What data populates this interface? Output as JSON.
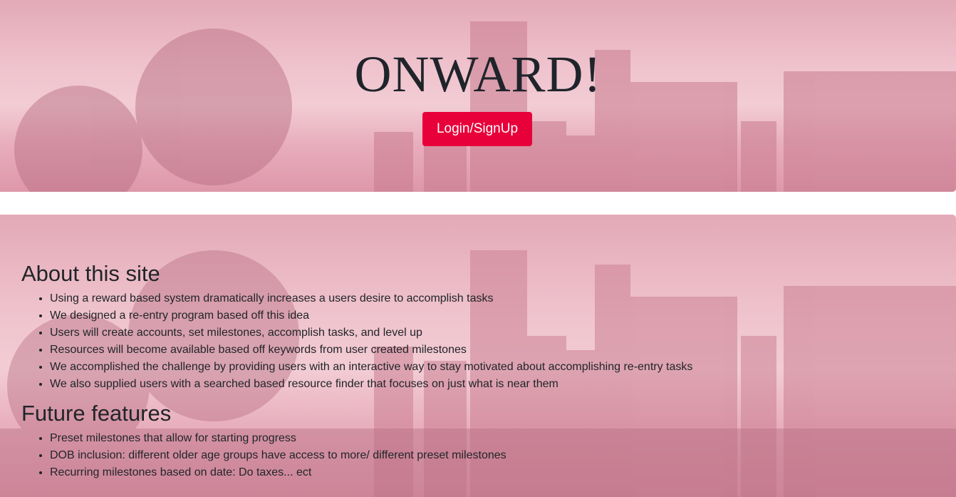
{
  "hero": {
    "title": "ONWARD!",
    "button_label": "Login/SignUp",
    "button_color": "#e8003a"
  },
  "about": {
    "heading": "About this site",
    "items": [
      "Using a reward based system dramatically increases a users desire to accomplish tasks",
      "We designed a re-entry program based off this idea",
      "Users will create accounts, set milestones, accomplish tasks, and level up",
      "Resources will become available based off keywords from user created milestones",
      "We accomplished the challenge by providing users with an interactive way to stay motivated about accomplishing re-entry tasks",
      "We also supplied users with a searched based resource finder that focuses on just what is near them"
    ]
  },
  "future": {
    "heading": "Future features",
    "items": [
      "Preset milestones that allow for starting progress",
      "DOB inclusion: different older age groups have access to more/ different preset milestones",
      "Recurring milestones based on date: Do taxes... ect"
    ]
  },
  "theme": {
    "background_tint": "#e8aebd"
  }
}
